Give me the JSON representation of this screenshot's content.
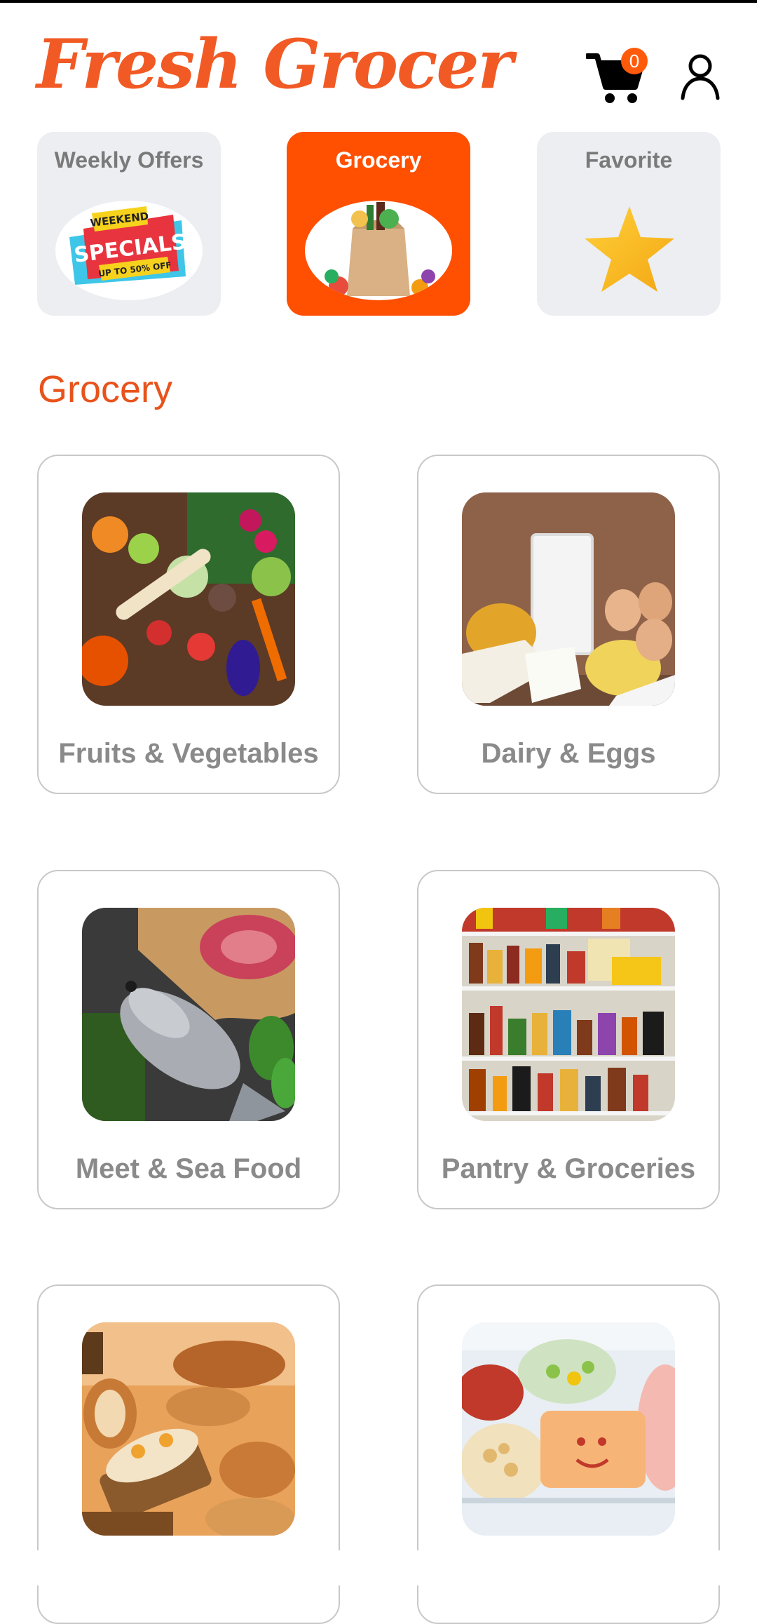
{
  "app": {
    "title": "Fresh Grocer"
  },
  "header": {
    "cart_count": "0"
  },
  "tabs": [
    {
      "label": "Weekly Offers",
      "active": false
    },
    {
      "label": "Grocery",
      "active": true
    },
    {
      "label": "Favorite",
      "active": false
    }
  ],
  "offer_badge": {
    "line1": "WEEKEND",
    "line2": "SPECIALS",
    "line3": "UP TO 50% OFF"
  },
  "section": {
    "title": "Grocery"
  },
  "categories": [
    {
      "label": "Fruits & Vegetables"
    },
    {
      "label": "Dairy & Eggs"
    },
    {
      "label": "Meet & Sea Food"
    },
    {
      "label": "Pantry & Groceries"
    },
    {
      "label": ""
    },
    {
      "label": ""
    }
  ],
  "colors": {
    "brand": "#f15a24",
    "active_tab": "#ff4f00",
    "badge": "#ff5a0a",
    "tab_bg": "#eceef1"
  }
}
